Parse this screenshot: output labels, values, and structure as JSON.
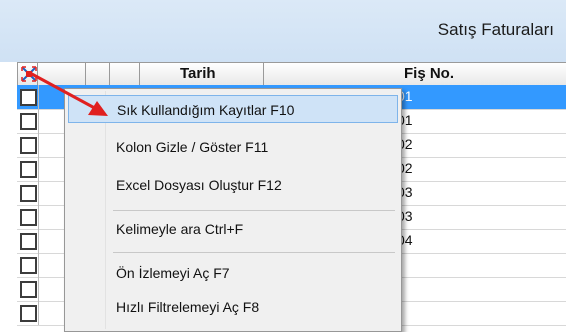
{
  "window": {
    "title": "Satış Faturaları"
  },
  "grid": {
    "headers": {
      "tarih": "Tarih",
      "fis_no": "Fiş No."
    },
    "rows": [
      {
        "fis": "01",
        "selected": true
      },
      {
        "fis": "01"
      },
      {
        "fis": "02"
      },
      {
        "fis": "02"
      },
      {
        "fis": "03"
      },
      {
        "fis": "03"
      },
      {
        "fis": "04"
      },
      {
        "fis": ""
      }
    ]
  },
  "context_menu": {
    "items": [
      {
        "label": "Sık Kullandığım Kayıtlar  F10"
      },
      {
        "label": "Kolon Gizle / Göster  F11"
      },
      {
        "label": "Excel Dosyası Oluştur F12"
      },
      {
        "label": "Kelimeyle ara  Ctrl+F"
      },
      {
        "label": "Ön İzlemeyi Aç F7"
      },
      {
        "label": "Hızlı Filtrelemeyi Aç F8"
      }
    ]
  },
  "colors": {
    "selection": "#3399ff",
    "menu_hover": "#cfe3f7",
    "arrow": "#e02020"
  }
}
